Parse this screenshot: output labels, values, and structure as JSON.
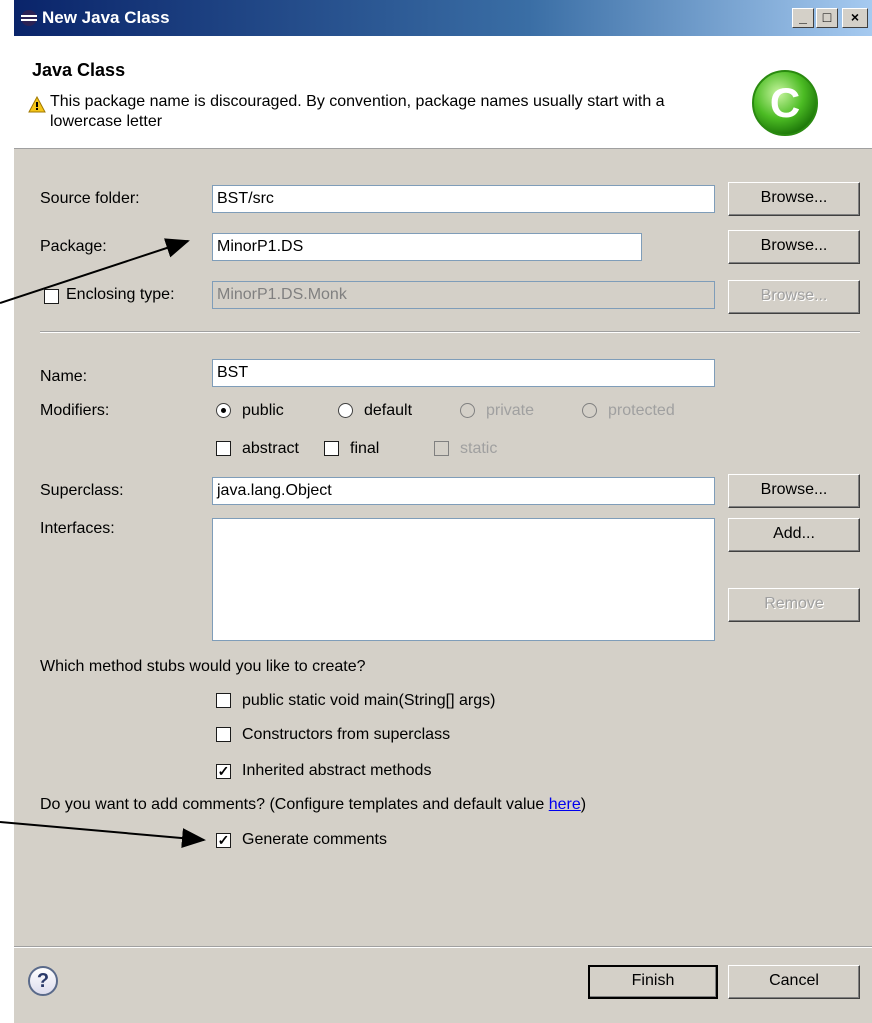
{
  "window": {
    "title": "New Java Class",
    "minimize": "_",
    "maximize": "□",
    "close": "×"
  },
  "header": {
    "title": "Java Class",
    "message": "This package name is discouraged. By convention, package names usually start with a lowercase letter"
  },
  "source_folder": {
    "label": "Source folder:",
    "value": "BST/src",
    "browse": "Browse..."
  },
  "package": {
    "label": "Package:",
    "value": "MinorP1.DS",
    "browse": "Browse..."
  },
  "enclosing": {
    "label": "Enclosing type:",
    "value": "MinorP1.DS.Monk",
    "browse": "Browse..."
  },
  "name": {
    "label": "Name:",
    "value": "BST"
  },
  "modifiers": {
    "label": "Modifiers:",
    "public": "public",
    "default": "default",
    "private": "private",
    "protected": "protected",
    "abstract": "abstract",
    "final": "final",
    "static": "static"
  },
  "superclass": {
    "label": "Superclass:",
    "value": "java.lang.Object",
    "browse": "Browse..."
  },
  "interfaces": {
    "label": "Interfaces:",
    "add": "Add...",
    "remove": "Remove"
  },
  "stubs": {
    "question": "Which method stubs would you like to create?",
    "main": "public static void main(String[] args)",
    "constructors": "Constructors from superclass",
    "inherited": "Inherited abstract methods"
  },
  "comments": {
    "question_before": "Do you want to add comments? (Configure templates and default value ",
    "link": "here",
    "question_after": ")",
    "generate": "Generate comments"
  },
  "footer": {
    "help": "?",
    "finish": "Finish",
    "cancel": "Cancel"
  }
}
